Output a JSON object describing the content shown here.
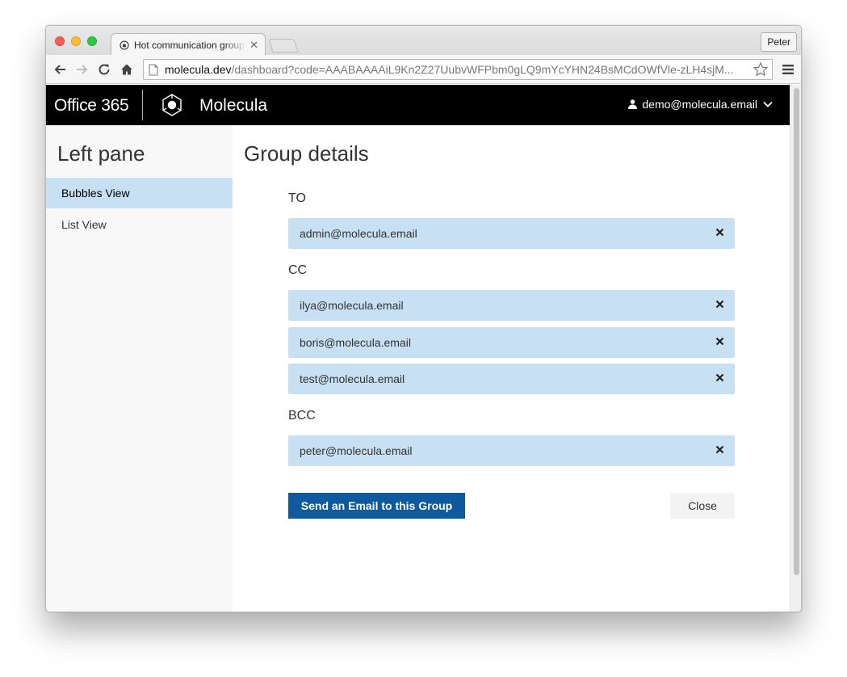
{
  "browser": {
    "tab_title": "Hot communication groups",
    "tab_close_icon": "close-icon",
    "profile_name": "Peter",
    "url_host": "molecula.dev",
    "url_path": "/dashboard?code=AAABAAAAiL9Kn2Z27UubvWFPbm0gLQ9mYcYHN24BsMCdOWfVle-zLH4sjM...",
    "icons": [
      "back-icon",
      "forward-icon",
      "reload-icon",
      "home-icon",
      "page-icon",
      "bookmark-star-icon",
      "menu-icon"
    ]
  },
  "header": {
    "suite": "Office 365",
    "app_name": "Molecula",
    "user_email": "demo@molecula.email",
    "icons": [
      "molecula-logo-icon",
      "user-icon",
      "chevron-down-icon"
    ]
  },
  "left_pane": {
    "title": "Left pane",
    "items": [
      {
        "label": "Bubbles View",
        "active": true
      },
      {
        "label": "List View",
        "active": false
      }
    ]
  },
  "main": {
    "title": "Group details",
    "sections": [
      {
        "label": "TO",
        "recipients": [
          "admin@molecula.email"
        ]
      },
      {
        "label": "CC",
        "recipients": [
          "ilya@molecula.email",
          "boris@molecula.email",
          "test@molecula.email"
        ]
      },
      {
        "label": "BCC",
        "recipients": [
          "peter@molecula.email"
        ]
      }
    ],
    "send_button": "Send an Email to this Group",
    "close_button": "Close"
  },
  "colors": {
    "accent": "#0f5a9c",
    "bubble": "#c7e0f4",
    "header_bg": "#000000"
  }
}
